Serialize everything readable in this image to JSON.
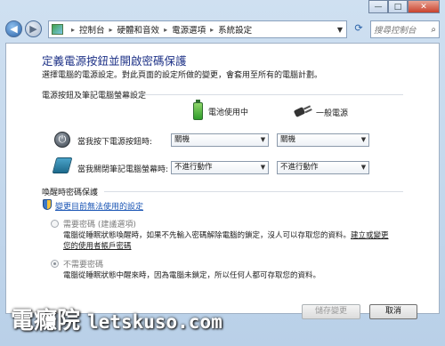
{
  "window": {
    "minimize": "—",
    "maximize": "□",
    "close": "✕"
  },
  "nav": {
    "back": "◀",
    "forward": "▶",
    "breadcrumb": [
      "控制台",
      "硬體和音效",
      "電源選項",
      "系統設定"
    ],
    "separator": "▸",
    "refresh": "⟳",
    "search_placeholder": "搜尋控制台",
    "search_icon": "⌕"
  },
  "page": {
    "title": "定義電源按鈕並開啟密碼保護",
    "description": "選擇電腦的電源設定。對此頁面的設定所做的變更，會套用至所有的電腦計劃。"
  },
  "power_section": {
    "heading": "電源按鈕及筆記電腦螢幕設定",
    "col_battery": "電池使用中",
    "col_plugged": "一般電源",
    "rows": [
      {
        "icon": "power-button-icon",
        "label": "當我按下電源按鈕時:",
        "battery": "關機",
        "plugged": "關機"
      },
      {
        "icon": "laptop-lid-icon",
        "label": "當我關閉筆記電腦螢幕時:",
        "battery": "不進行動作",
        "plugged": "不進行動作"
      }
    ]
  },
  "wake_section": {
    "heading": "喚醒時密碼保護",
    "change_link": "變更目前無法使用的設定",
    "options": [
      {
        "label": "需要密碼 (建議選項)",
        "desc_line1": "電腦從睡眠狀態喚醒時，如果不先輸入密碼解除電腦的鎖定，沒人可以存取您的資料。",
        "link_part1": "建立或變更",
        "link_part2": "您的使用者帳戶密碼",
        "checked": false
      },
      {
        "label": "不需要密碼",
        "desc_line1": "電腦從睡眠狀態中醒來時，因為電腦未鎖定，所以任何人都可存取您的資料。",
        "checked": true
      }
    ]
  },
  "buttons": {
    "save": "儲存變更",
    "cancel": "取消"
  },
  "watermark": {
    "brand": "電癮院",
    "site": "letskuso.com"
  }
}
